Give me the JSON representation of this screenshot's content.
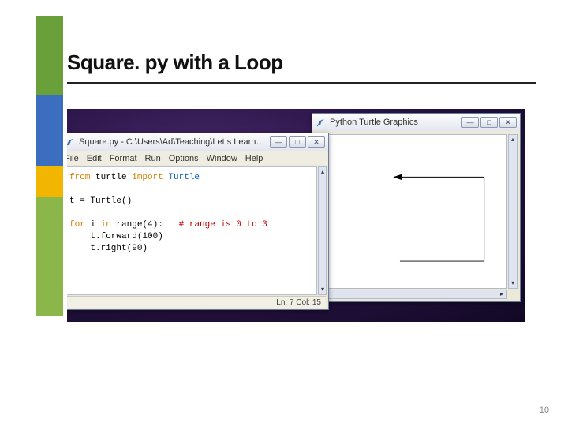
{
  "slide": {
    "title": "Square. py with a Loop",
    "page_number": "10"
  },
  "turtle_window": {
    "title": "Python Turtle Graphics",
    "feather_icon": "feather-icon",
    "buttons": {
      "min": "—",
      "max": "□",
      "close": "✕"
    }
  },
  "editor_window": {
    "title": "Square.py - C:\\Users\\Ad\\Teaching\\Let s Learn Python\\...",
    "feather_icon": "feather-icon",
    "buttons": {
      "min": "—",
      "max": "□",
      "close": "✕"
    },
    "menus": {
      "file": "File",
      "edit": "Edit",
      "format": "Format",
      "run": "Run",
      "options": "Options",
      "window": "Window",
      "help": "Help"
    },
    "code": {
      "l1_kw_from": "from",
      "l1_mod": " turtle ",
      "l1_kw_import": "import",
      "l1_name": " Turtle",
      "l3": "t = Turtle()",
      "l5_kw_for": "for",
      "l5_var": " i ",
      "l5_kw_in": "in",
      "l5_call": " range(4):   ",
      "l5_cm": "# range is 0 to 3",
      "l6": "    t.forward(100)",
      "l7": "    t.right(90)"
    },
    "status": "Ln: 7  Col: 15"
  }
}
